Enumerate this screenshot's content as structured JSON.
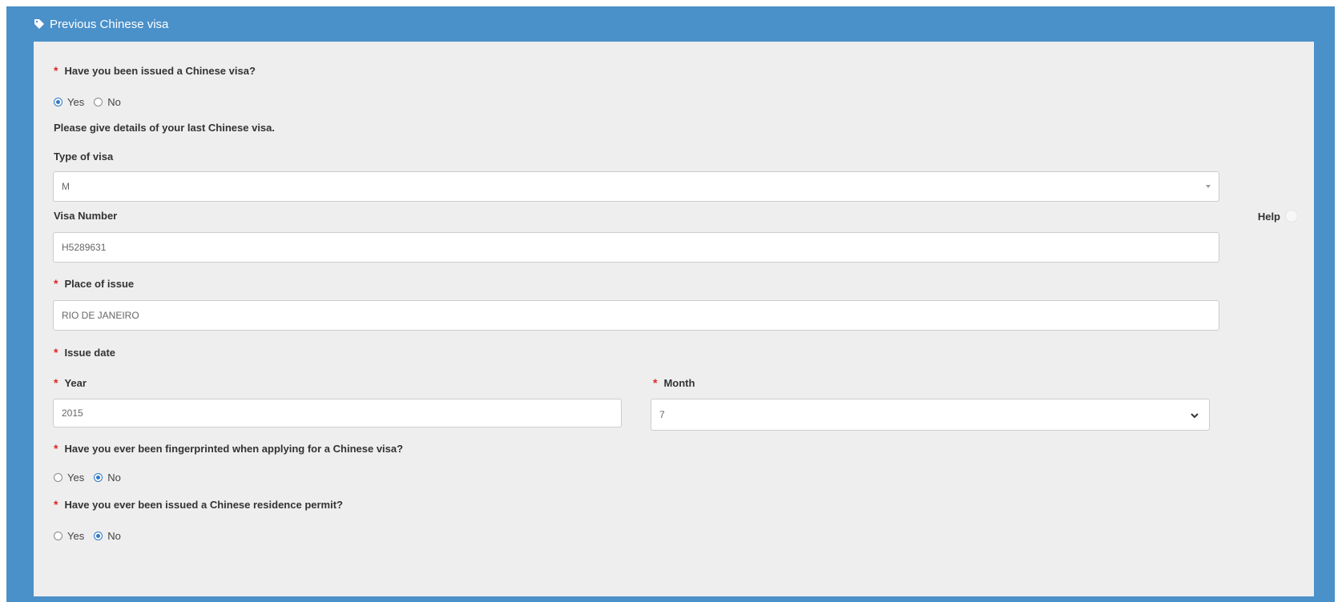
{
  "panel": {
    "title": "Previous Chinese visa",
    "icon": "tag-icon",
    "header_color": "#4a90c9"
  },
  "form": {
    "issued_visa": {
      "question": "Have you been issued a Chinese visa?",
      "options": [
        "Yes",
        "No"
      ],
      "selected": "Yes"
    },
    "details_note": "Please give details of your last Chinese visa.",
    "visa_type": {
      "label": "Type of visa",
      "value": "M"
    },
    "visa_number": {
      "label": "Visa Number",
      "help_label": "Help",
      "value": "H5289631"
    },
    "place_of_issue": {
      "label": "Place of issue",
      "value": "RIO DE JANEIRO"
    },
    "issue_date": {
      "label": "Issue date",
      "year_label": "Year",
      "year_value": "2015",
      "month_label": "Month",
      "month_value": "7"
    },
    "fingerprinted": {
      "question": "Have you ever been fingerprinted when applying for a Chinese visa?",
      "options": [
        "Yes",
        "No"
      ],
      "selected": "No"
    },
    "residence_permit": {
      "question": "Have you ever been issued a Chinese residence permit?",
      "options": [
        "Yes",
        "No"
      ],
      "selected": "No"
    },
    "required_marker": "*"
  }
}
